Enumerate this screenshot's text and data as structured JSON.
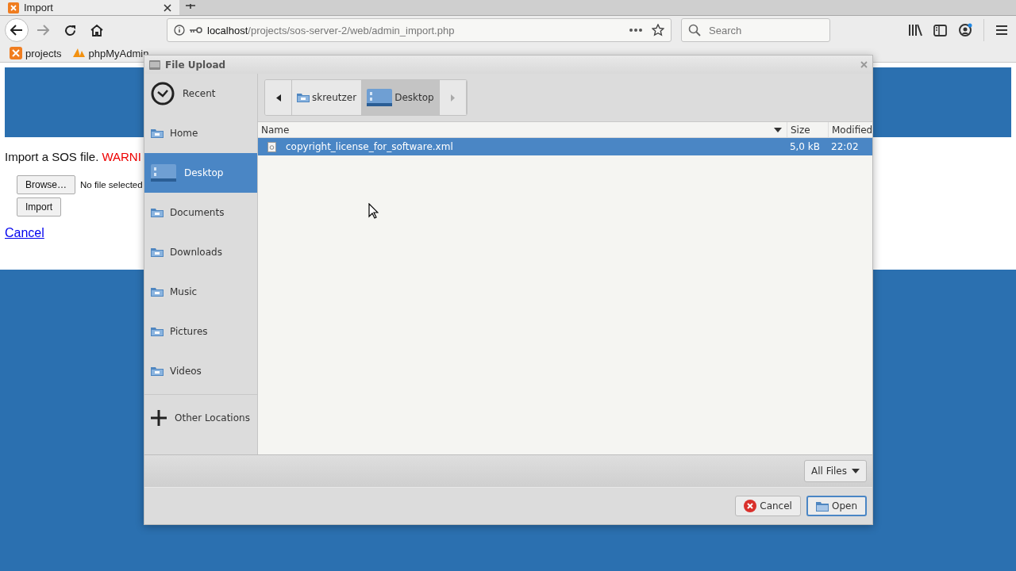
{
  "browser": {
    "tab": {
      "title": "Import"
    },
    "url": {
      "host": "localhost",
      "path": "/projects/sos-server-2/web/admin_import.php"
    },
    "search": {
      "placeholder": "Search"
    },
    "bookmarks": [
      {
        "kind": "xampp",
        "label": "projects"
      },
      {
        "kind": "pma",
        "label": "phpMyAdmin"
      }
    ]
  },
  "page": {
    "intro": "Import a SOS file.",
    "warning": "WARNI",
    "browse_button": "Browse…",
    "file_status": "No file selected",
    "import_button": "Import",
    "cancel_link": "Cancel"
  },
  "dialog": {
    "title": "File Upload",
    "places": [
      {
        "kind": "recent",
        "label": "Recent",
        "selected": false
      },
      {
        "kind": "home",
        "label": "Home",
        "selected": false
      },
      {
        "kind": "desktop",
        "label": "Desktop",
        "selected": true
      },
      {
        "kind": "folder",
        "label": "Documents",
        "selected": false
      },
      {
        "kind": "folder",
        "label": "Downloads",
        "selected": false
      },
      {
        "kind": "folder",
        "label": "Music",
        "selected": false
      },
      {
        "kind": "folder",
        "label": "Pictures",
        "selected": false
      },
      {
        "kind": "folder",
        "label": "Videos",
        "selected": false
      },
      {
        "kind": "other",
        "label": "Other Locations",
        "selected": false
      }
    ],
    "path": [
      {
        "kind": "home",
        "label": "skreutzer",
        "selected": false
      },
      {
        "kind": "desktop",
        "label": "Desktop",
        "selected": true
      }
    ],
    "columns": [
      "Name",
      "Size",
      "Modified"
    ],
    "files": [
      {
        "name": "copyright_license_for_software.xml",
        "size": "5,0 kB",
        "modified": "22:02",
        "selected": true
      }
    ],
    "filter": "All Files",
    "cancel_button": "Cancel",
    "open_button": "Open"
  }
}
